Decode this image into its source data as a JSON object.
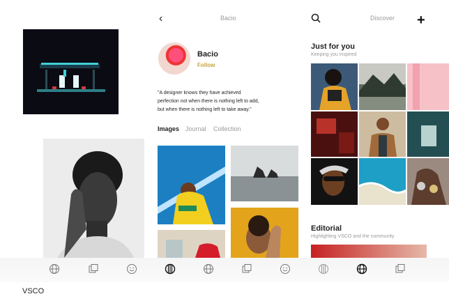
{
  "caption": "VSCO",
  "profile": {
    "header_title": "Bacio",
    "name": "Bacio",
    "follow_label": "Follow",
    "quote_line1": "\"A designer knows they have achieved",
    "quote_line2": "perfection not when there is nothing left to add,",
    "quote_line3": "but when there is nothing left to take away.\"",
    "tabs": [
      "Images",
      "Journal",
      "Collection"
    ]
  },
  "discover": {
    "header_title": "Discover",
    "just_for_you_title": "Just for you",
    "just_for_you_sub": "Keeping you inspired",
    "editorial_title": "Editorial",
    "editorial_sub": "Highlighting VSCO and the community"
  },
  "nav_icons": [
    "globe-icon",
    "gallery-icon",
    "smiley-icon",
    "vsco-logo-icon",
    "globe-icon",
    "gallery-icon",
    "smiley-icon",
    "vsco-logo-icon",
    "globe-icon",
    "gallery-icon"
  ],
  "colors": {
    "accent_follow": "#c9a23a",
    "muted_text": "#9a9a9a"
  }
}
